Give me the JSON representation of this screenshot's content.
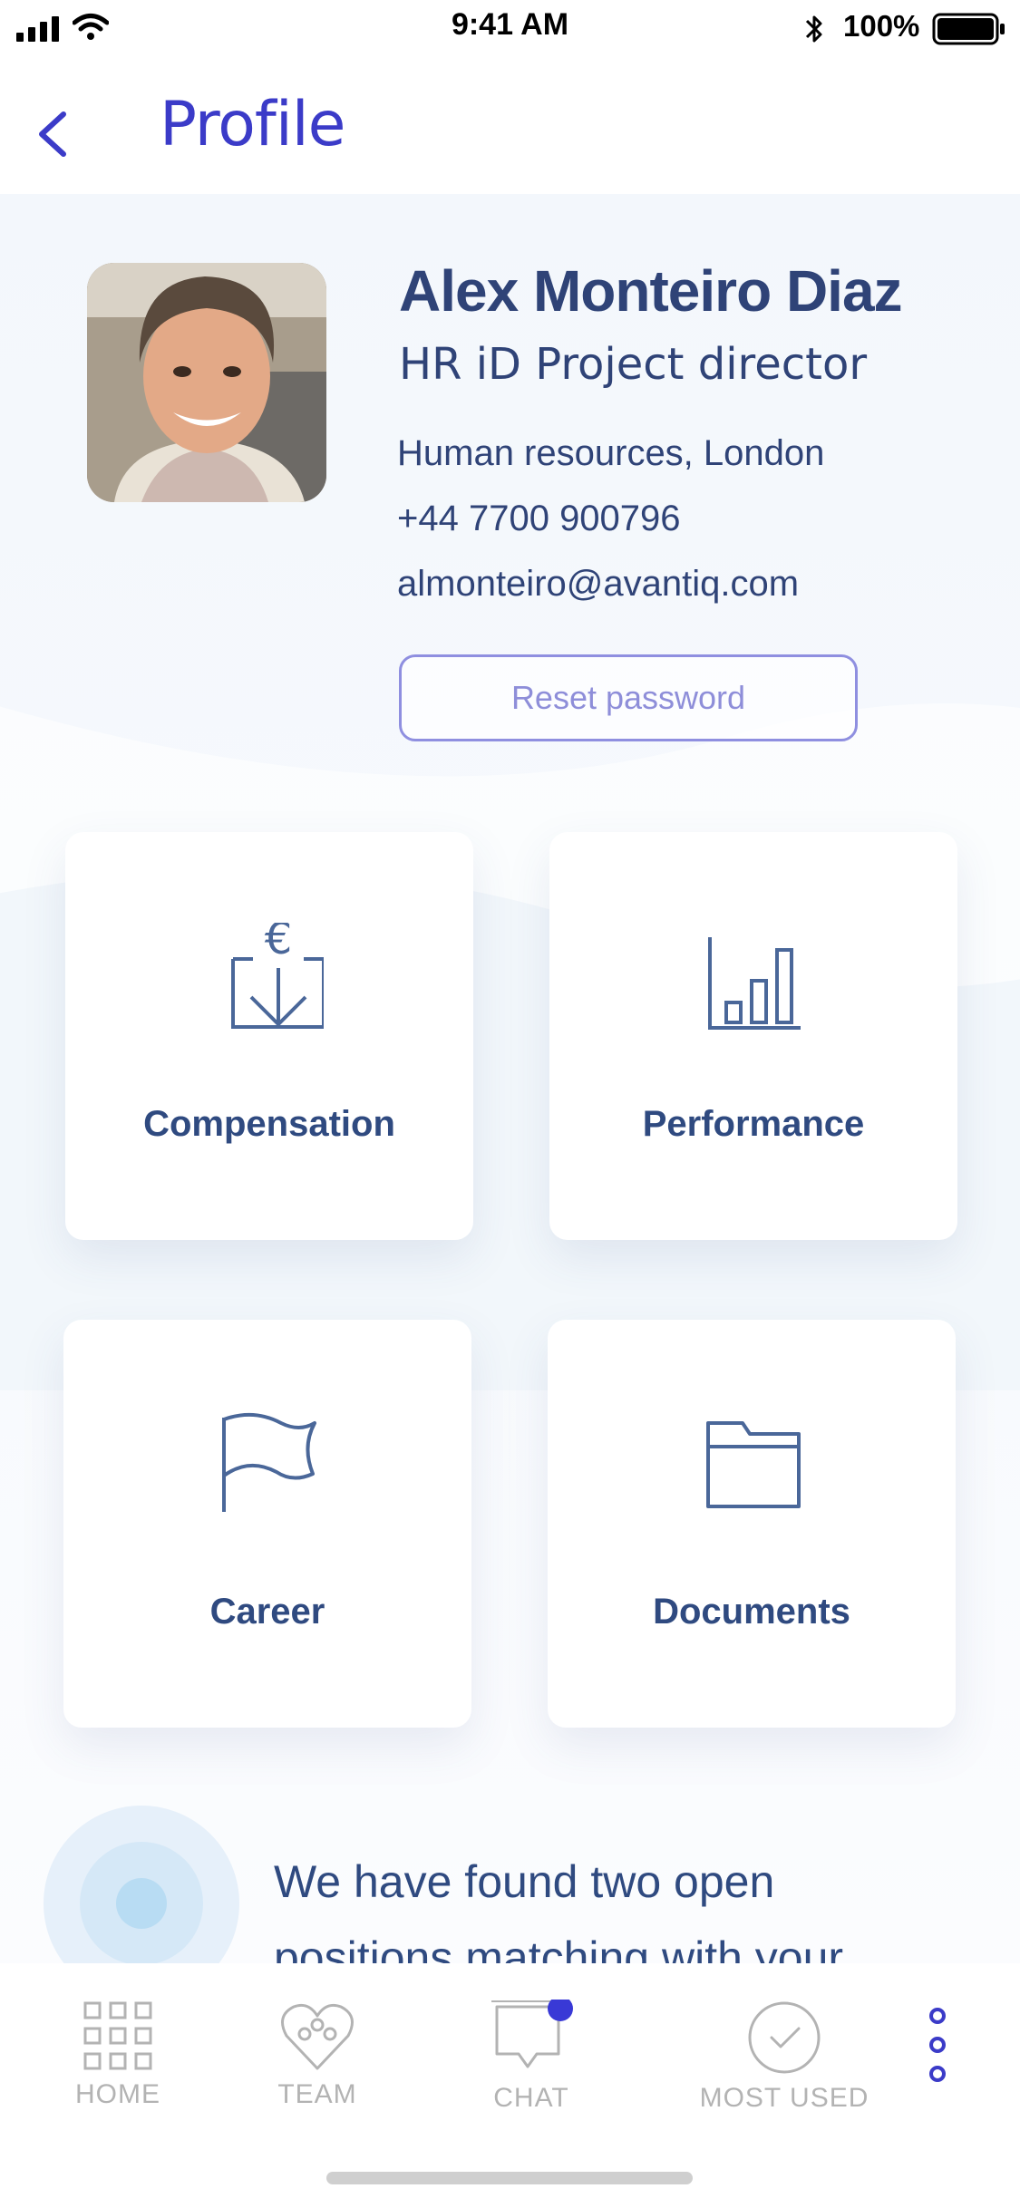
{
  "status_bar": {
    "time": "9:41 AM",
    "battery": "100%"
  },
  "header": {
    "title": "Profile"
  },
  "profile": {
    "name": "Alex Monteiro Diaz",
    "job_title": "HR iD Project director",
    "department": "Human resources, London",
    "phone": "+44 7700 900796",
    "email": "almonteiro@avantiq.com",
    "reset_label": "Reset password"
  },
  "cards": [
    {
      "label": "Compensation",
      "icon": "euro-download-icon"
    },
    {
      "label": "Performance",
      "icon": "bar-chart-icon"
    },
    {
      "label": "Career",
      "icon": "flag-icon"
    },
    {
      "label": "Documents",
      "icon": "folder-icon"
    }
  ],
  "message": {
    "text": "We have found two open positions matching with your"
  },
  "tabbar": {
    "items": [
      {
        "label": "HOME",
        "icon": "grid-icon"
      },
      {
        "label": "TEAM",
        "icon": "team-heart-icon"
      },
      {
        "label": "CHAT",
        "icon": "chat-icon"
      },
      {
        "label": "MOST USED",
        "icon": "check-circle-icon"
      }
    ],
    "more_icon": "more-vertical-icon"
  },
  "colors": {
    "accent": "#3b3bc8",
    "text": "#2f4377",
    "badge": "#3939d6",
    "tab_inactive": "#b3b3b3"
  }
}
